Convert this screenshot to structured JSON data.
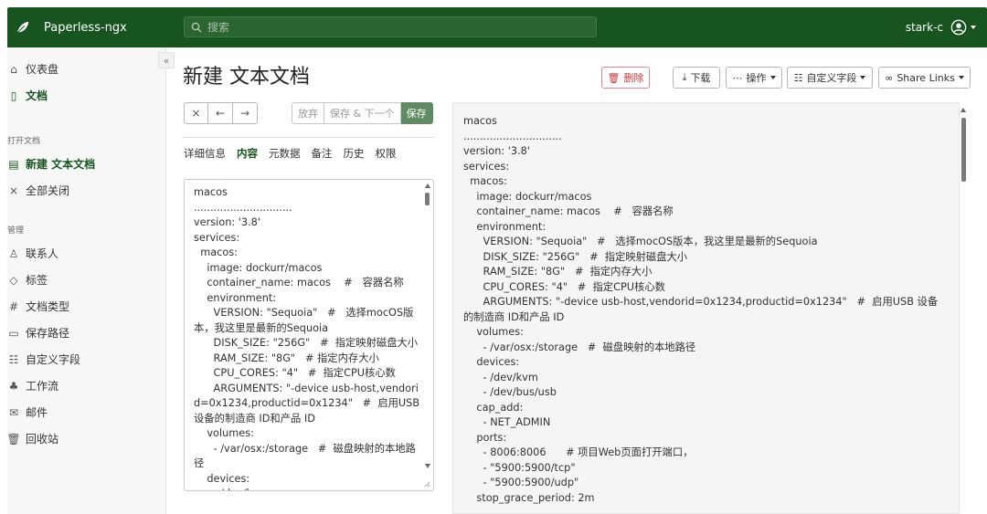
{
  "app": {
    "name": "Paperless-ngx",
    "user": "stark-c"
  },
  "search": {
    "placeholder": "搜索"
  },
  "sidebar": {
    "items": [
      {
        "label": "仪表盘",
        "icon": "house-icon"
      },
      {
        "label": "文档",
        "icon": "file-icon",
        "active": true
      }
    ],
    "open_section": "打开文档",
    "open_items": [
      {
        "label": "新建 文本文档",
        "icon": "file-text-icon",
        "active": true
      },
      {
        "label": "全部关闭",
        "icon": "close-icon"
      }
    ],
    "manage_section": "管理",
    "manage_items": [
      {
        "label": "联系人",
        "icon": "person-icon"
      },
      {
        "label": "标签",
        "icon": "tag-icon"
      },
      {
        "label": "文档类型",
        "icon": "hash-icon"
      },
      {
        "label": "保存路径",
        "icon": "folder-icon"
      },
      {
        "label": "自定义字段",
        "icon": "ui-checks-icon"
      },
      {
        "label": "工作流",
        "icon": "diagram-icon"
      },
      {
        "label": "邮件",
        "icon": "envelope-icon"
      },
      {
        "label": "回收站",
        "icon": "trash-icon"
      }
    ]
  },
  "page": {
    "title": "新建 文本文档"
  },
  "toolbar": {
    "delete": "删除",
    "download": "下载",
    "actions": "操作",
    "custom_fields": "自定义字段",
    "share_links": "Share Links"
  },
  "nav_buttons": {
    "close": "×",
    "prev": "←",
    "next": "→"
  },
  "save_buttons": {
    "discard": "放弃",
    "save_next": "保存 & 下一个",
    "save": "保存"
  },
  "tabs": [
    {
      "label": "详细信息"
    },
    {
      "label": "内容",
      "active": true
    },
    {
      "label": "元数据"
    },
    {
      "label": "备注"
    },
    {
      "label": "历史"
    },
    {
      "label": "权限"
    }
  ],
  "editor": {
    "content": "macos\n..............................\nversion: '3.8'\nservices:\n  macos:\n    image: dockurr/macos\n    container_name: macos    #   容器名称\n    environment:\n      VERSION: \"Sequoia\"   #   选择mocOS版本，我这里是最新的Sequoia\n      DISK_SIZE: \"256G\"   #  指定映射磁盘大小\n      RAM_SIZE: \"8G\"   # 指定内存大小\n      CPU_CORES: \"4\"   #  指定CPU核心数\n      ARGUMENTS: \"-device usb-host,vendorid=0x1234,productid=0x1234\"   #  启用USB 设备的制造商 ID和产品 ID\n    volumes:\n      - /var/osx:/storage   #  磁盘映射的本地路径\n    devices:\n      - /dev/kvm\n      - /dev/bus/usb"
  },
  "preview": {
    "content": "macos\n..............................\nversion: '3.8'\nservices:\n  macos:\n    image: dockurr/macos\n    container_name: macos    #   容器名称\n    environment:\n      VERSION: \"Sequoia\"   #   选择mocOS版本，我这里是最新的Sequoia\n      DISK_SIZE: \"256G\"   #  指定映射磁盘大小\n      RAM_SIZE: \"8G\"   #  指定内存大小\n      CPU_CORES: \"4\"   #  指定CPU核心数\n      ARGUMENTS: \"-device usb-host,vendorid=0x1234,productid=0x1234\"   #  启用USB 设备的制造商 ID和产品 ID\n    volumes:\n      - /var/osx:/storage   #  磁盘映射的本地路径\n    devices:\n      - /dev/kvm\n      - /dev/bus/usb\n    cap_add:\n      - NET_ADMIN\n    ports:\n      - 8006:8006      # 项目Web页面打开端口，\n      - \"5900:5900/tcp\"\n      - \"5900:5900/udp\"\n    stop_grace_period: 2m"
  },
  "colors": {
    "brand": "#17541f",
    "primary_button": "#5f8a63",
    "danger": "#c23b3b"
  }
}
